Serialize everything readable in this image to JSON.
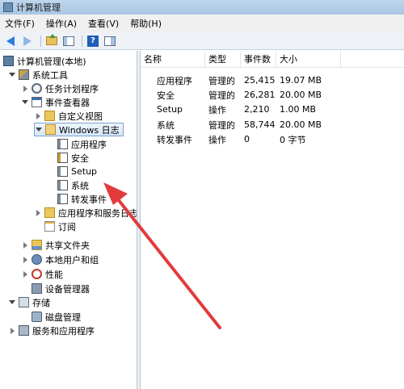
{
  "window": {
    "title": "计算机管理"
  },
  "menu": [
    "文件(F)",
    "操作(A)",
    "查看(V)",
    "帮助(H)"
  ],
  "tree": {
    "root": "计算机管理(本地)",
    "system_tools": "系统工具",
    "task_scheduler": "任务计划程序",
    "event_viewer": "事件查看器",
    "custom_views": "自定义视图",
    "windows_logs": "Windows 日志",
    "log_application": "应用程序",
    "log_security": "安全",
    "log_setup": "Setup",
    "log_system": "系统",
    "log_forwarded": "转发事件",
    "apps_services_logs": "应用程序和服务日志",
    "subscriptions": "订阅",
    "shared_folders": "共享文件夹",
    "local_users": "本地用户和组",
    "performance": "性能",
    "device_manager": "设备管理器",
    "storage": "存储",
    "disk_management": "磁盘管理",
    "services_apps": "服务和应用程序"
  },
  "list": {
    "columns": [
      "名称",
      "类型",
      "事件数",
      "大小"
    ],
    "rows": [
      {
        "name": "应用程序",
        "type": "管理的",
        "count": "25,415",
        "size": "19.07 MB"
      },
      {
        "name": "安全",
        "type": "管理的",
        "count": "26,281",
        "size": "20.00 MB"
      },
      {
        "name": "Setup",
        "type": "操作",
        "count": "2,210",
        "size": "1.00 MB"
      },
      {
        "name": "系统",
        "type": "管理的",
        "count": "58,744",
        "size": "20.00 MB"
      },
      {
        "name": "转发事件",
        "type": "操作",
        "count": "0",
        "size": "0 字节"
      }
    ]
  },
  "colors": {
    "arrow": "#e23b3b",
    "selection_border": "#7da2ce"
  },
  "icons": {
    "back": "back-arrow-icon",
    "forward": "forward-arrow-icon",
    "up": "folder-up-icon",
    "help": "help-icon"
  }
}
